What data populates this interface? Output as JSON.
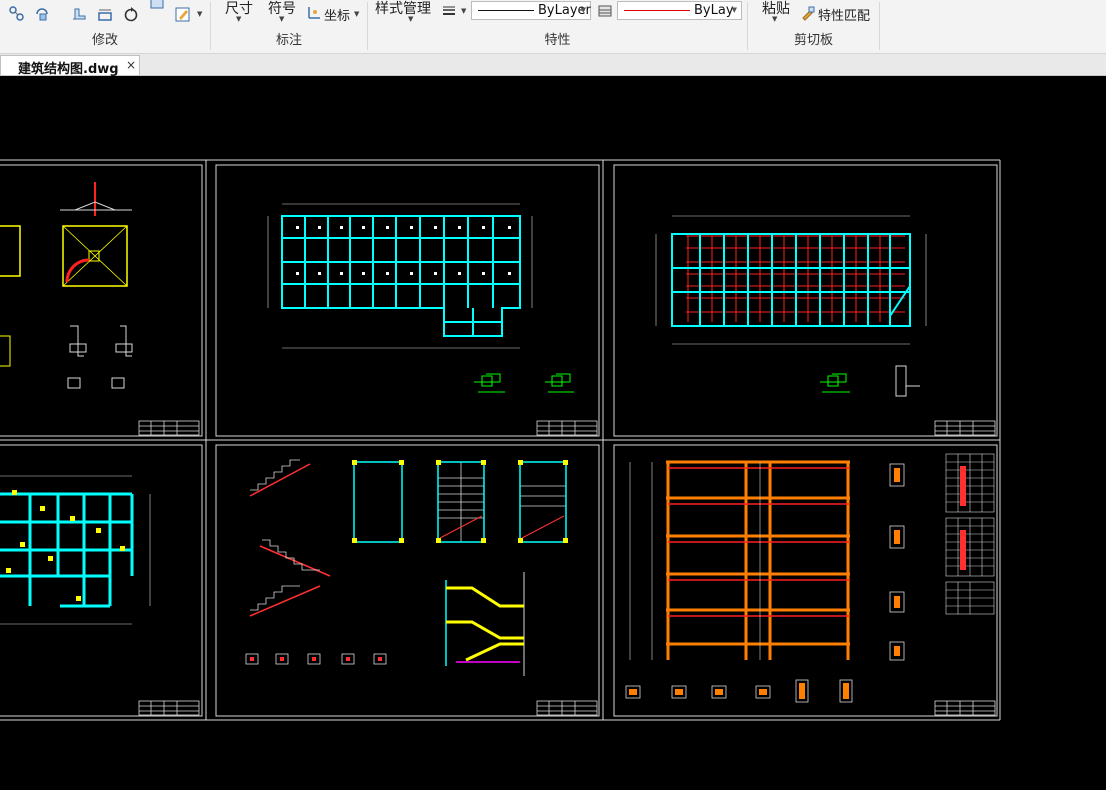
{
  "ribbon": {
    "modify": {
      "label": "修改"
    },
    "annotate": {
      "label": "标注",
      "dimension": "尺寸",
      "symbol": "符号",
      "coordinate": "坐标"
    },
    "properties": {
      "label": "特性",
      "style_manager": "样式管理",
      "linetype_value": "ByLayer",
      "color_value": "ByLay­o",
      "color_display": "ByLay"
    },
    "clipboard": {
      "label": "剪切板",
      "paste": "粘贴",
      "match_properties": "特性匹配"
    }
  },
  "tabs": [
    {
      "label": "建筑结构图.dwg",
      "close": "×"
    }
  ],
  "colors": {
    "canvas": "#000000",
    "ribbon": "#f3f3f3",
    "cyan": "#00ffff",
    "red": "#ff0000",
    "yellow": "#ffff00",
    "orange": "#ff8000",
    "green": "#00ff00"
  }
}
